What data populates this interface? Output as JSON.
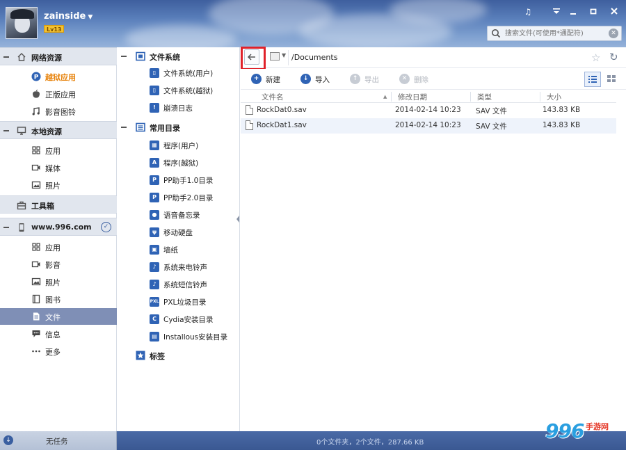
{
  "user": {
    "name": "zainside",
    "level": "Lv13"
  },
  "search": {
    "placeholder": "搜索文件(可使用*通配符)"
  },
  "sidebar": {
    "sections": [
      {
        "title": "网络资源",
        "items": [
          "越狱应用",
          "正版应用",
          "影音图铃"
        ]
      },
      {
        "title": "本地资源",
        "items": [
          "应用",
          "媒体",
          "照片"
        ]
      },
      {
        "title": "工具箱",
        "items": []
      },
      {
        "title": "www.996.com",
        "items": [
          "应用",
          "影音",
          "照片",
          "图书",
          "文件",
          "信息",
          "更多"
        ]
      }
    ]
  },
  "tree": {
    "filesystem": {
      "title": "文件系统",
      "items": [
        "文件系统(用户)",
        "文件系统(越狱)",
        "崩溃日志"
      ]
    },
    "common": {
      "title": "常用目录",
      "items": [
        "程序(用户)",
        "程序(越狱)",
        "PP助手1.0目录",
        "PP助手2.0目录",
        "语音备忘录",
        "移动硬盘",
        "墙纸",
        "系统来电铃声",
        "系统短信铃声",
        "PXL垃圾目录",
        "Cydia安装目录",
        "Installous安装目录"
      ]
    },
    "bookmarks": {
      "title": "标签"
    }
  },
  "address": {
    "path": "/Documents"
  },
  "toolbar": {
    "new": "新建",
    "import": "导入",
    "export": "导出",
    "delete": "删除"
  },
  "table": {
    "columns": [
      "文件名",
      "修改日期",
      "类型",
      "大小"
    ],
    "rows": [
      {
        "name": "RockDat0.sav",
        "date": "2014-02-14 10:23",
        "type": "SAV 文件",
        "size": "143.83 KB"
      },
      {
        "name": "RockDat1.sav",
        "date": "2014-02-14 10:23",
        "type": "SAV 文件",
        "size": "143.83 KB"
      }
    ]
  },
  "status": {
    "tasks": "无任务",
    "summary": "0个文件夹，2个文件，287.66 KB"
  },
  "watermark": {
    "number": "996",
    "text": "手游网"
  },
  "colors": {
    "accent": "#2f63b5",
    "highlight": "#e0222a",
    "selected": "#7f8fb6",
    "orange": "#e7820a"
  }
}
